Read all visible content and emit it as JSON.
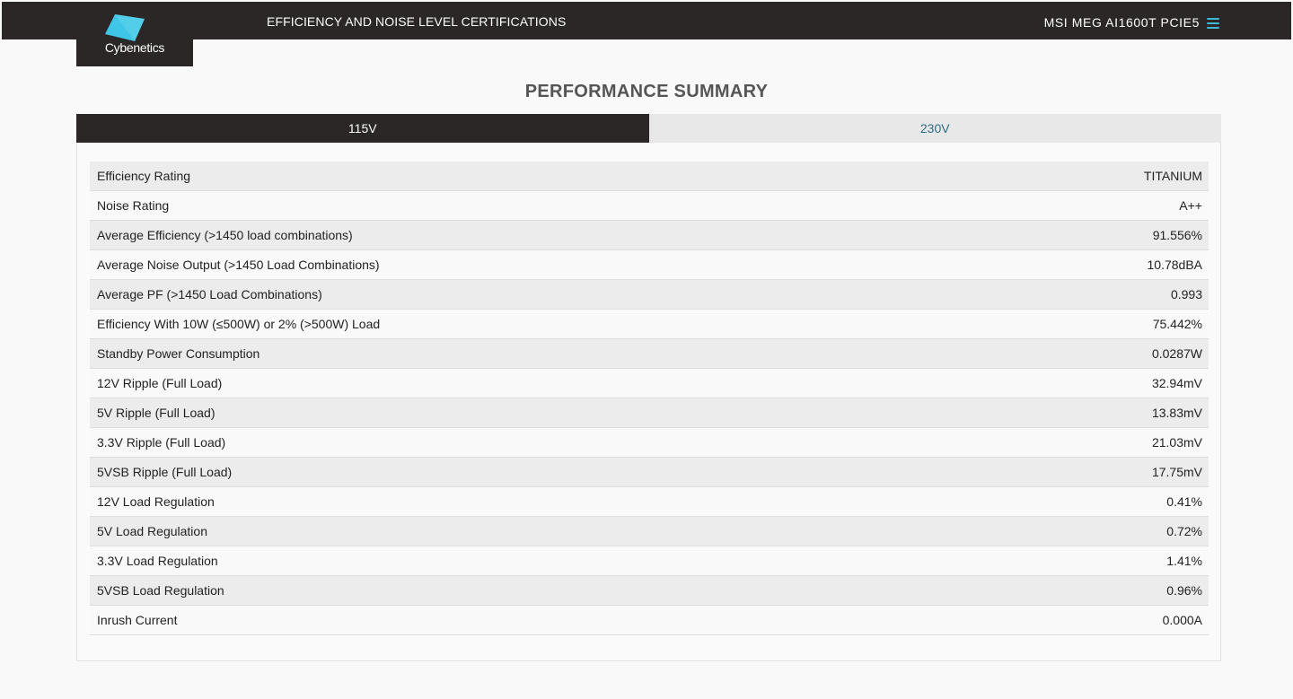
{
  "header": {
    "title": "EFFICIENCY AND NOISE LEVEL CERTIFICATIONS",
    "product": "MSI MEG AI1600T PCIE5",
    "menu_icon": "hamburger-menu-icon"
  },
  "logo": {
    "text": "Cybenetics",
    "accent_color": "#3fc6e6"
  },
  "summary": {
    "title": "PERFORMANCE SUMMARY"
  },
  "tabs": [
    {
      "label": "115V",
      "active": true
    },
    {
      "label": "230V",
      "active": false
    }
  ],
  "rows": [
    {
      "label": "Efficiency Rating",
      "value": "TITANIUM"
    },
    {
      "label": "Noise Rating",
      "value": "A++"
    },
    {
      "label": "Average Efficiency (>1450 load combinations)",
      "value": "91.556%"
    },
    {
      "label": "Average Noise Output (>1450 Load Combinations)",
      "value": "10.78dBA"
    },
    {
      "label": "Average PF (>1450 Load Combinations)",
      "value": "0.993"
    },
    {
      "label": "Efficiency With 10W (≤500W) or 2% (>500W) Load",
      "value": "75.442%"
    },
    {
      "label": "Standby Power Consumption",
      "value": "0.0287W"
    },
    {
      "label": "12V Ripple (Full Load)",
      "value": "32.94mV"
    },
    {
      "label": "5V Ripple (Full Load)",
      "value": "13.83mV"
    },
    {
      "label": "3.3V Ripple (Full Load)",
      "value": "21.03mV"
    },
    {
      "label": "5VSB Ripple (Full Load)",
      "value": "17.75mV"
    },
    {
      "label": "12V Load Regulation",
      "value": "0.41%"
    },
    {
      "label": "5V Load Regulation",
      "value": "0.72%"
    },
    {
      "label": "3.3V Load Regulation",
      "value": "1.41%"
    },
    {
      "label": "5VSB Load Regulation",
      "value": "0.96%"
    },
    {
      "label": "Inrush Current",
      "value": "0.000A"
    }
  ]
}
